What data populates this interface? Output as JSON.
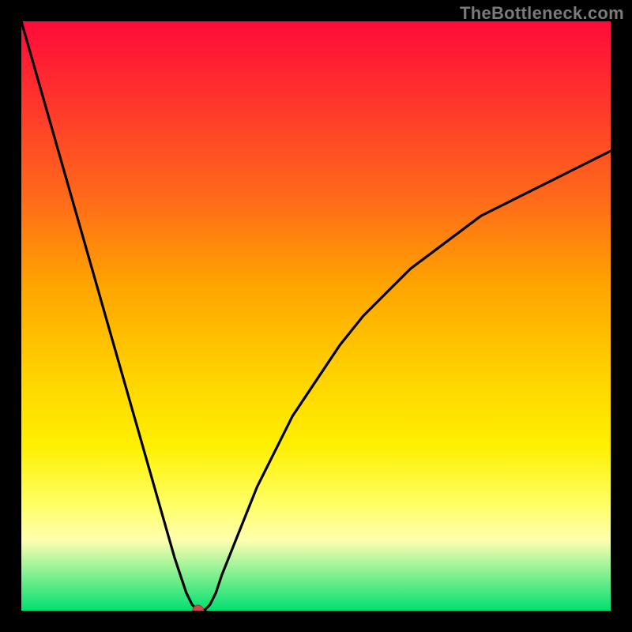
{
  "watermark": "TheBottleneck.com",
  "chart_data": {
    "type": "line",
    "title": "",
    "xlabel": "",
    "ylabel": "",
    "xlim": [
      0,
      100
    ],
    "ylim": [
      0,
      100
    ],
    "grid": false,
    "background": "rainbow-vertical",
    "marker": {
      "x": 30,
      "y": 0,
      "color": "#c84c4c"
    },
    "series": [
      {
        "name": "bottleneck-curve",
        "x": [
          0,
          2,
          4,
          6,
          8,
          10,
          12,
          14,
          16,
          18,
          20,
          22,
          24,
          26,
          27,
          28,
          29,
          30,
          31,
          32,
          33,
          34,
          36,
          38,
          40,
          42,
          44,
          46,
          48,
          50,
          54,
          58,
          62,
          66,
          70,
          74,
          78,
          82,
          86,
          90,
          94,
          98,
          100
        ],
        "y": [
          100,
          93,
          86,
          79,
          72,
          65,
          58,
          51,
          44,
          37,
          30,
          23,
          16,
          9,
          6,
          3,
          1,
          0,
          0,
          1,
          3,
          6,
          11,
          16,
          21,
          25,
          29,
          33,
          36,
          39,
          45,
          50,
          54,
          58,
          61,
          64,
          67,
          69,
          71,
          73,
          75,
          77,
          78
        ]
      }
    ]
  }
}
